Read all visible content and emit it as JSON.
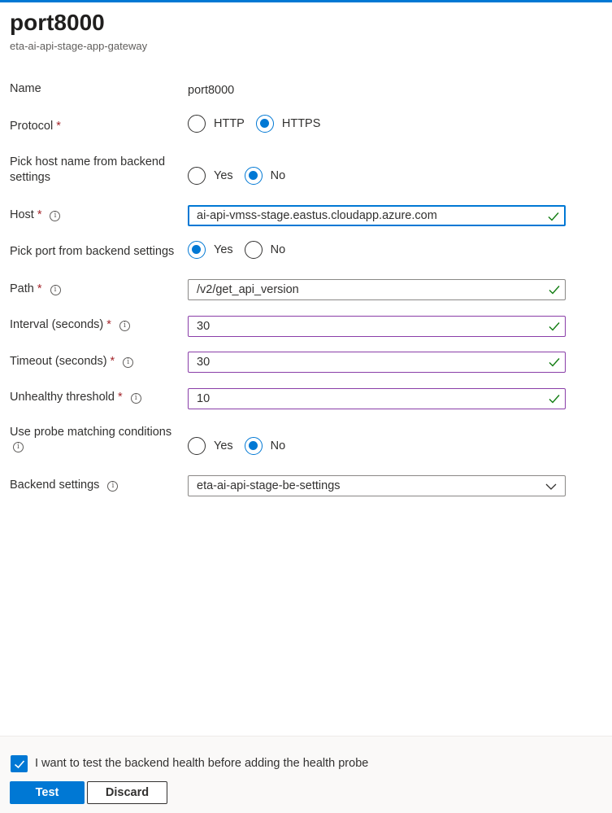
{
  "header": {
    "title": "port8000",
    "subtitle": "eta-ai-api-stage-app-gateway"
  },
  "form": {
    "name": {
      "label": "Name",
      "value": "port8000"
    },
    "protocol": {
      "label": "Protocol",
      "required": "*",
      "options": [
        "HTTP",
        "HTTPS"
      ],
      "selected": "HTTPS"
    },
    "pick_host": {
      "label_line1": "Pick host name from backend",
      "label_line2": "settings",
      "options": [
        "Yes",
        "No"
      ],
      "selected": "No"
    },
    "host": {
      "label": "Host",
      "required": "*",
      "info": "i",
      "value": "ai-api-vmss-stage.eastus.cloudapp.azure.com"
    },
    "pick_port": {
      "label": "Pick port from backend settings",
      "options": [
        "Yes",
        "No"
      ],
      "selected": "Yes"
    },
    "path": {
      "label": "Path",
      "required": "*",
      "info": "i",
      "value": "/v2/get_api_version"
    },
    "interval": {
      "label": "Interval (seconds)",
      "required": "*",
      "info": "i",
      "value": "30"
    },
    "timeout": {
      "label": "Timeout (seconds)",
      "required": "*",
      "info": "i",
      "value": "30"
    },
    "unhealthy": {
      "label": "Unhealthy threshold",
      "required": "*",
      "info": "i",
      "value": "10"
    },
    "probe_match": {
      "label": "Use probe matching conditions",
      "info": "i",
      "options": [
        "Yes",
        "No"
      ],
      "selected": "No"
    },
    "backend_settings": {
      "label": "Backend settings",
      "info": "i",
      "value": "eta-ai-api-stage-be-settings"
    }
  },
  "footer": {
    "checkbox_label": "I want to test the backend health before adding the health probe",
    "checkbox_checked": true,
    "test_label": "Test",
    "discard_label": "Discard"
  },
  "icons": {
    "valid": "checkmark-icon",
    "dropdown": "chevron-down-icon",
    "info": "info-icon"
  },
  "colors": {
    "accent": "#0078d4",
    "valid": "#107c10",
    "required": "#a4262c",
    "edited_border": "#8a3ea8"
  }
}
